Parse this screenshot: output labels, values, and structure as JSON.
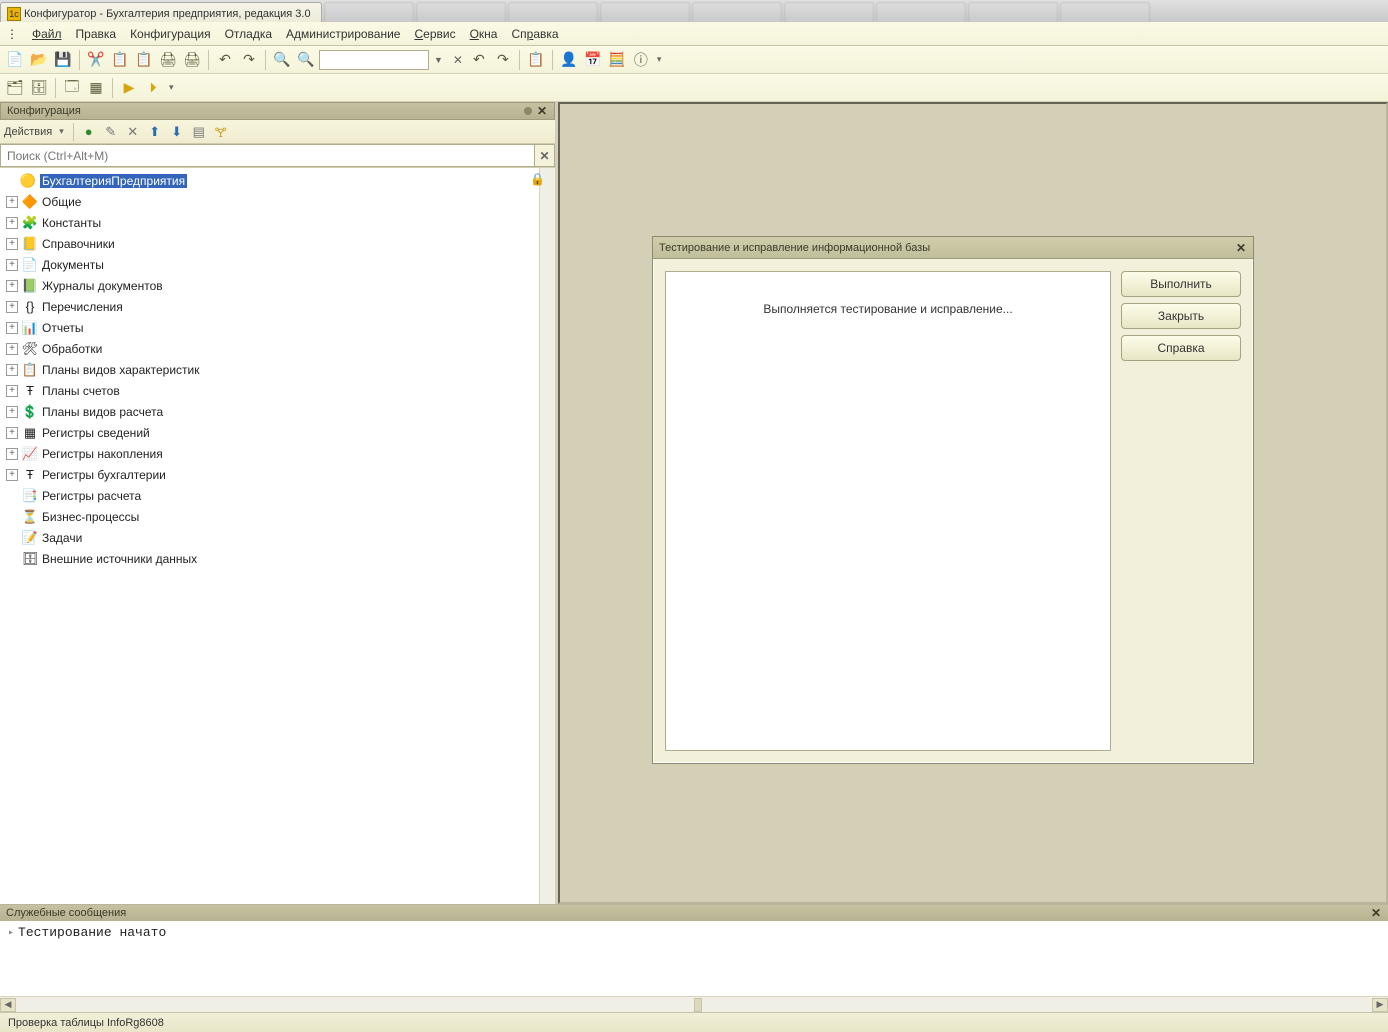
{
  "tabs": {
    "active": "Конфигуратор - Бухгалтерия предприятия, редакция 3.0"
  },
  "menu": {
    "file": "Файл",
    "edit": "Правка",
    "config": "Конфигурация",
    "debug": "Отладка",
    "admin": "Администрирование",
    "service": "Сервис",
    "windows": "Окна",
    "help": "Справка"
  },
  "left_panel": {
    "title": "Конфигурация",
    "actions_label": "Действия",
    "search_placeholder": "Поиск (Ctrl+Alt+M)"
  },
  "tree": [
    {
      "expand": "",
      "icon": "🟡",
      "label": "БухгалтерияПредприятия",
      "selected": true,
      "lock": true
    },
    {
      "expand": "+",
      "icon": "🔶",
      "label": "Общие"
    },
    {
      "expand": "+",
      "icon": "🧩",
      "label": "Константы"
    },
    {
      "expand": "+",
      "icon": "📒",
      "label": "Справочники"
    },
    {
      "expand": "+",
      "icon": "📄",
      "label": "Документы"
    },
    {
      "expand": "+",
      "icon": "📗",
      "label": "Журналы документов"
    },
    {
      "expand": "+",
      "icon": "{}",
      "label": "Перечисления"
    },
    {
      "expand": "+",
      "icon": "📊",
      "label": "Отчеты"
    },
    {
      "expand": "+",
      "icon": "🛠",
      "label": "Обработки"
    },
    {
      "expand": "+",
      "icon": "📋",
      "label": "Планы видов характеристик"
    },
    {
      "expand": "+",
      "icon": "Ŧ",
      "label": "Планы счетов"
    },
    {
      "expand": "+",
      "icon": "💲",
      "label": "Планы видов расчета"
    },
    {
      "expand": "+",
      "icon": "▦",
      "label": "Регистры сведений"
    },
    {
      "expand": "+",
      "icon": "📈",
      "label": "Регистры накопления"
    },
    {
      "expand": "+",
      "icon": "Ŧ",
      "label": "Регистры бухгалтерии"
    },
    {
      "expand": "",
      "icon": "📑",
      "label": "Регистры расчета"
    },
    {
      "expand": "",
      "icon": "⏳",
      "label": "Бизнес-процессы"
    },
    {
      "expand": "",
      "icon": "📝",
      "label": "Задачи"
    },
    {
      "expand": "",
      "icon": "🗄",
      "label": "Внешние источники данных"
    }
  ],
  "dialog": {
    "title": "Тестирование и исправление информационной базы",
    "message": "Выполняется тестирование и исправление...",
    "btn_run": "Выполнить",
    "btn_close": "Закрыть",
    "btn_help": "Справка"
  },
  "messages": {
    "title": "Служебные сообщения",
    "line1": "Тестирование начато"
  },
  "status": "Проверка таблицы InfoRg8608"
}
